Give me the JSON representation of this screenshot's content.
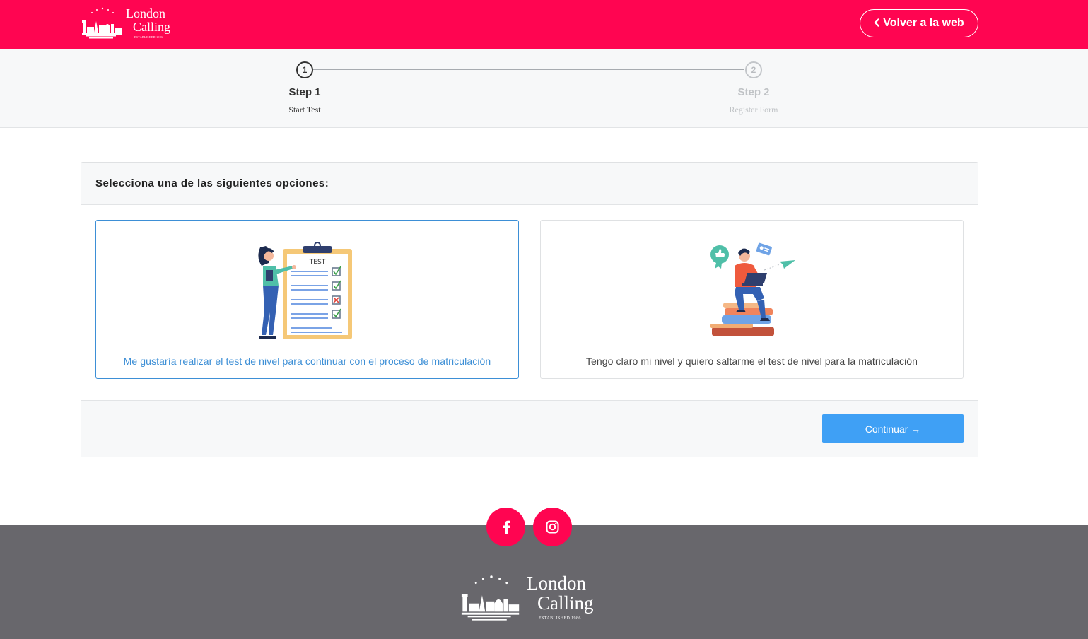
{
  "brand": {
    "name_line1": "London",
    "name_line2": "Calling",
    "established": "ESTABLISHED 1986",
    "color": "#ff0551"
  },
  "header": {
    "back_label": "Volver a la web",
    "back_icon": "chevron-left-icon"
  },
  "steps": [
    {
      "number": "1",
      "title": "Step 1",
      "subtitle": "Start Test",
      "active": true
    },
    {
      "number": "2",
      "title": "Step 2",
      "subtitle": "Register Form",
      "active": false
    }
  ],
  "card": {
    "heading": "Selecciona una de las siguientes opciones:",
    "options": [
      {
        "caption": "Me gustaría realizar el test de nivel para continuar con el proceso de matriculación",
        "selected": true,
        "illustration": "test-clipboard-illustration",
        "clipboard_label": "TEST"
      },
      {
        "caption": "Tengo claro mi nivel y quiero saltarme el test de nivel para la matriculación",
        "selected": false,
        "illustration": "student-on-books-illustration"
      }
    ],
    "continue_label": "Continuar →",
    "continue_color": "#3fa0f5",
    "selected_color": "#3d8fd6"
  },
  "footer": {
    "social": [
      {
        "name": "facebook",
        "icon": "facebook-icon"
      },
      {
        "name": "instagram",
        "icon": "instagram-icon"
      }
    ],
    "background": "#68676c"
  }
}
